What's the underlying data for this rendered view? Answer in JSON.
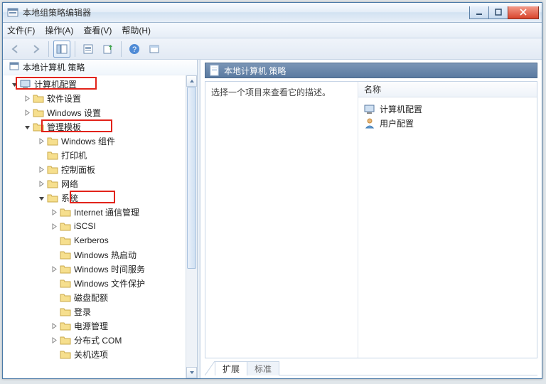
{
  "window": {
    "title": "本地组策略编辑器"
  },
  "menu": {
    "file": "文件(F)",
    "action": "操作(A)",
    "view": "查看(V)",
    "help": "帮助(H)"
  },
  "tree": {
    "root": "本地计算机 策略",
    "computer_config": "计算机配置",
    "software_settings": "软件设置",
    "windows_settings": "Windows 设置",
    "admin_templates": "管理模板",
    "windows_components": "Windows 组件",
    "printers": "打印机",
    "control_panel": "控制面板",
    "network": "网络",
    "system": "系统",
    "internet_comm": "Internet 通信管理",
    "iscsi": "iSCSI",
    "kerberos": "Kerberos",
    "windows_hotstart": "Windows 热启动",
    "windows_time": "Windows 时间服务",
    "windows_fileprotect": "Windows 文件保护",
    "disk_quota": "磁盘配额",
    "logon": "登录",
    "power_mgmt": "电源管理",
    "dcom": "分布式 COM",
    "shutdown_opts": "关机选项"
  },
  "right": {
    "header": "本地计算机 策略",
    "desc": "选择一个项目来查看它的描述。",
    "col_name": "名称",
    "item_computer": "计算机配置",
    "item_user": "用户配置"
  },
  "tabs": {
    "extended": "扩展",
    "standard": "标准"
  }
}
